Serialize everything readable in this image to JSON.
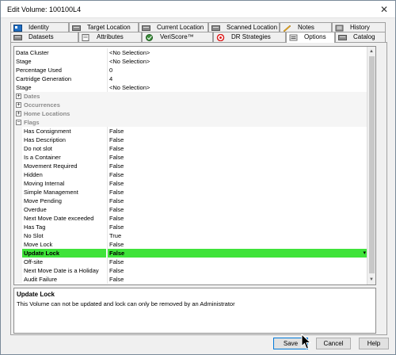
{
  "window": {
    "title": "Edit Volume: 100100L4",
    "close_glyph": "✕"
  },
  "tabs_row1": [
    {
      "label": "Identity",
      "icon": "identity-icon"
    },
    {
      "label": "Target Location",
      "icon": "target-location-icon"
    },
    {
      "label": "Current Location",
      "icon": "current-location-icon"
    },
    {
      "label": "Scanned Location",
      "icon": "scanned-location-icon"
    },
    {
      "label": "Notes",
      "icon": "notes-icon"
    },
    {
      "label": "History",
      "icon": "history-icon"
    }
  ],
  "tabs_row2": [
    {
      "label": "Datasets",
      "icon": "datasets-icon"
    },
    {
      "label": "Attributes",
      "icon": "attributes-icon"
    },
    {
      "label": "VeriScore™",
      "icon": "veriscore-icon"
    },
    {
      "label": "DR Strategies",
      "icon": "dr-strategies-icon"
    },
    {
      "label": "Options",
      "icon": "options-icon",
      "active": true
    },
    {
      "label": "Catalog",
      "icon": "catalog-icon"
    }
  ],
  "properties": [
    {
      "name": "Data Cluster",
      "value": "<No Selection>"
    },
    {
      "name": "Stage",
      "value": "<No Selection>"
    },
    {
      "name": "Percentage Used",
      "value": "0"
    },
    {
      "name": "Cartridge Generation",
      "value": "4"
    },
    {
      "name": "Stage",
      "value": "<No Selection>"
    }
  ],
  "categories": [
    {
      "label": "Dates",
      "expander": "+"
    },
    {
      "label": "Occurrences",
      "expander": "+"
    },
    {
      "label": "Home Locations",
      "expander": "+"
    },
    {
      "label": "Flags",
      "expander": "−"
    }
  ],
  "flags": [
    {
      "name": "Has Consignment",
      "value": "False"
    },
    {
      "name": "Has Description",
      "value": "False"
    },
    {
      "name": "Do not slot",
      "value": "False"
    },
    {
      "name": "Is a Container",
      "value": "False"
    },
    {
      "name": "Movement Required",
      "value": "False"
    },
    {
      "name": "Hidden",
      "value": "False"
    },
    {
      "name": "Moving Internal",
      "value": "False"
    },
    {
      "name": "Simple Management",
      "value": "False"
    },
    {
      "name": "Move Pending",
      "value": "False"
    },
    {
      "name": "Overdue",
      "value": "False"
    },
    {
      "name": "Next Move Date exceeded",
      "value": "False"
    },
    {
      "name": "Has Tag",
      "value": "False"
    },
    {
      "name": "No Slot",
      "value": "True"
    },
    {
      "name": "Move Lock",
      "value": "False"
    },
    {
      "name": "Update Lock",
      "value": "False",
      "selected": true
    },
    {
      "name": "Off-site",
      "value": "False"
    },
    {
      "name": "Next Move Date is a Holiday",
      "value": "False"
    },
    {
      "name": "Audit Failure",
      "value": "False"
    }
  ],
  "description": {
    "title": "Update Lock",
    "text": "This Volume can not be updated and lock can only be removed by an Administrator"
  },
  "buttons": {
    "save": "Save",
    "cancel": "Cancel",
    "help": "Help"
  },
  "colors": {
    "selected_row": "#3fe33a",
    "default_button_border": "#0078d7"
  }
}
